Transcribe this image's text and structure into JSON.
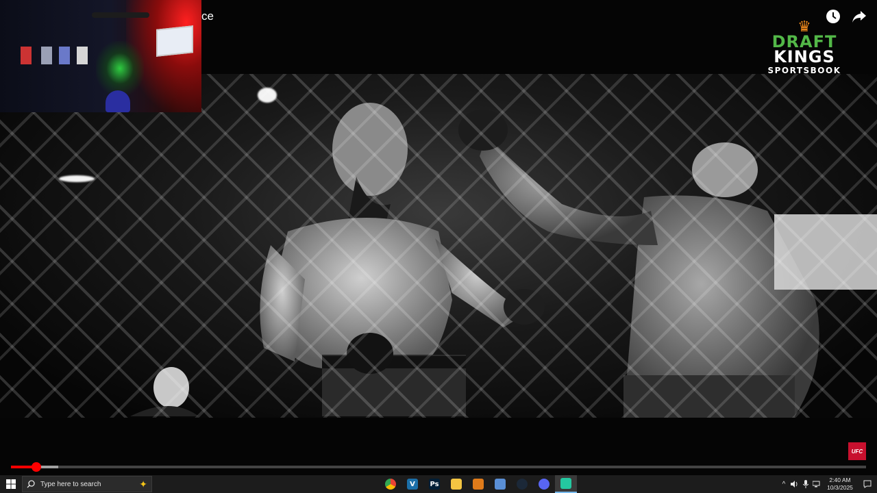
{
  "video": {
    "title_fragment": "ce",
    "progress_fraction": 0.03,
    "buffered_fraction": 0.055
  },
  "sponsor": {
    "line1": "DRAFT",
    "line2": "KINGS",
    "line3": "SPORTSBOOK",
    "crown_icon": "crown-icon",
    "brand_green": "#53b848",
    "brand_orange": "#f28b1c"
  },
  "badge": {
    "ufc": "UFC",
    "color": "#c8102e"
  },
  "top_icons": [
    "watch-later-icon",
    "share-icon"
  ],
  "taskbar": {
    "search_placeholder": "Type here to search",
    "apps": [
      {
        "name": "chrome",
        "glyph": "",
        "color": "#4285f4"
      },
      {
        "name": "vegas",
        "glyph": "V",
        "color": "#1b6fa8"
      },
      {
        "name": "photoshop",
        "glyph": "Ps",
        "color": "#001e36"
      },
      {
        "name": "file-explorer",
        "glyph": "",
        "color": "#f4c542"
      },
      {
        "name": "browser",
        "glyph": "",
        "color": "#e07b1a"
      },
      {
        "name": "app",
        "glyph": "",
        "color": "#5a8fd6"
      },
      {
        "name": "steam",
        "glyph": "",
        "color": "#1b2838"
      },
      {
        "name": "discord",
        "glyph": "",
        "color": "#5865f2"
      },
      {
        "name": "app-active",
        "glyph": "",
        "color": "#24c8a0"
      }
    ],
    "time": "2:40 AM",
    "date": "10/3/2025"
  },
  "accent": "#ff0000"
}
